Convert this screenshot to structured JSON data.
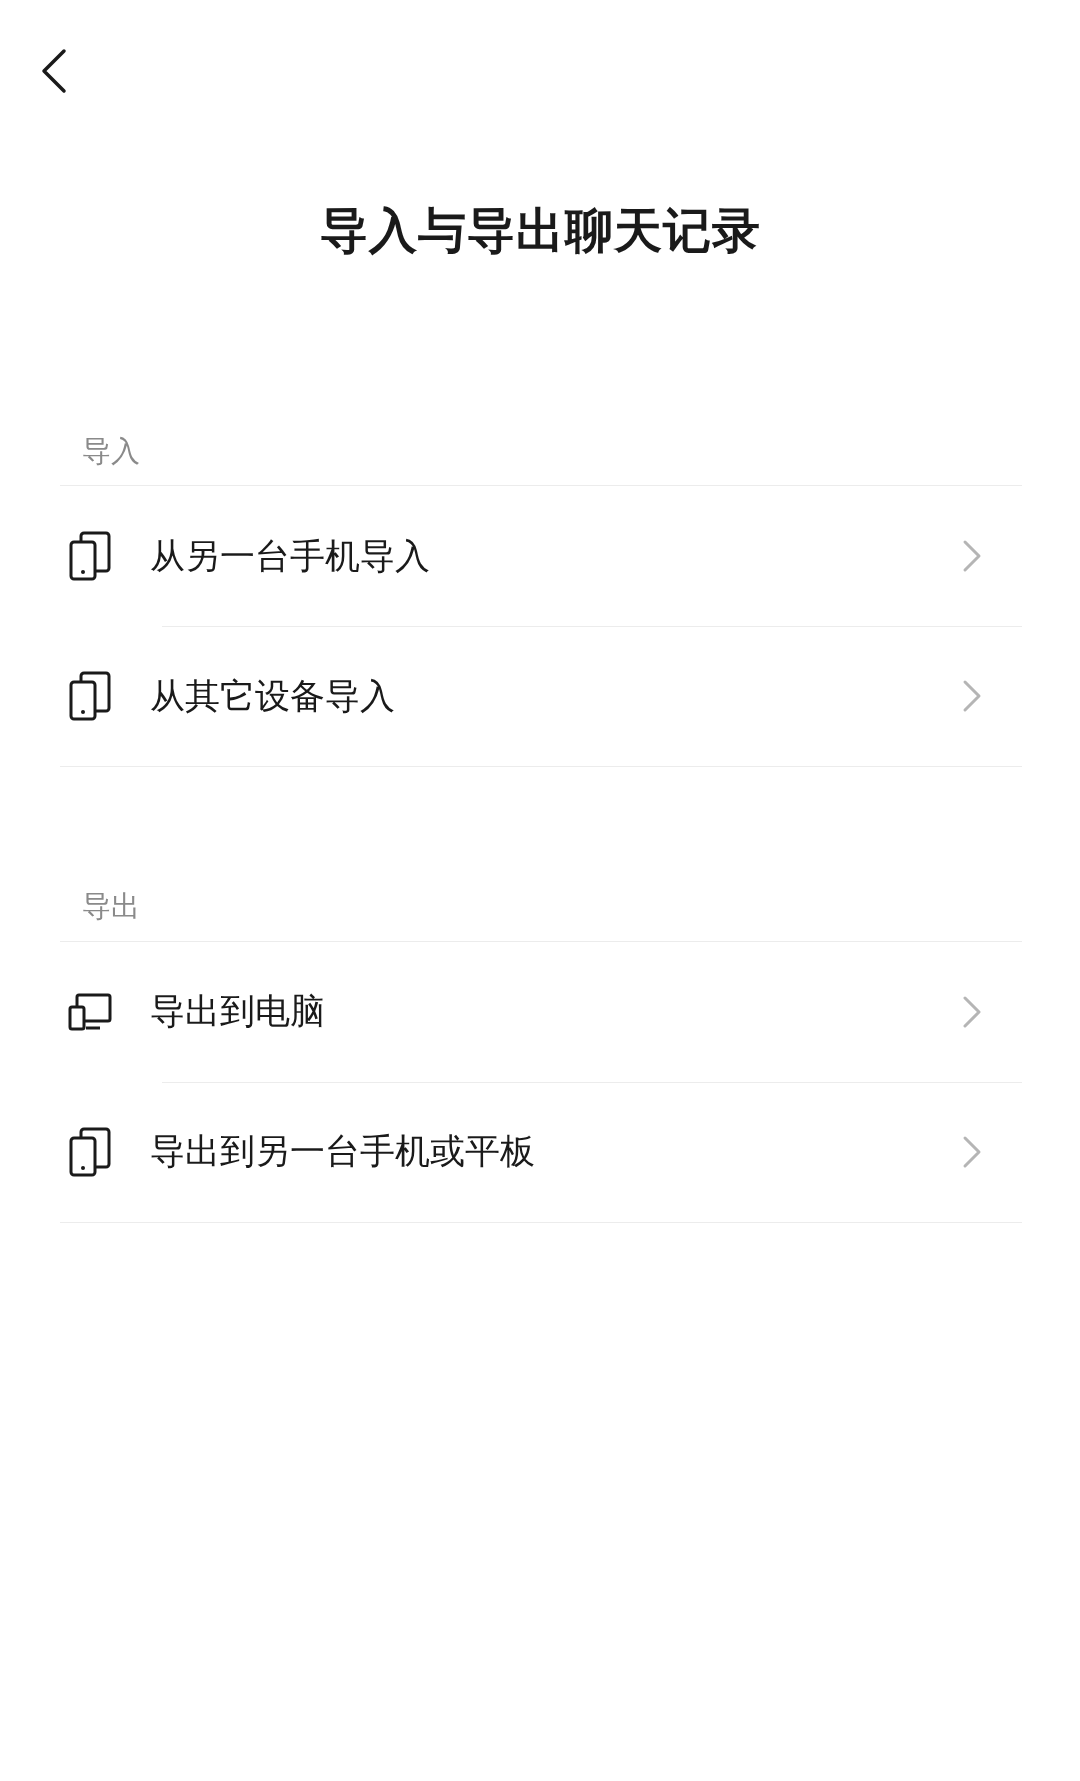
{
  "title": "导入与导出聊天记录",
  "sections": [
    {
      "label": "导入",
      "items": [
        {
          "label": "从另一台手机导入",
          "kind": "phone"
        },
        {
          "label": "从其它设备导入",
          "kind": "phone"
        }
      ]
    },
    {
      "label": "导出",
      "items": [
        {
          "label": "导出到电脑",
          "kind": "computer"
        },
        {
          "label": "导出到另一台手机或平板",
          "kind": "phone"
        }
      ]
    }
  ]
}
